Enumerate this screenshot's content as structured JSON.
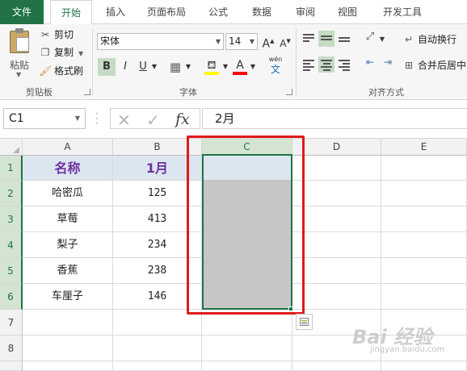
{
  "tabs": {
    "file": "文件",
    "home": "开始",
    "insert": "插入",
    "layout": "页面布局",
    "formulas": "公式",
    "data": "数据",
    "review": "审阅",
    "view": "视图",
    "developer": "开发工具"
  },
  "ribbon": {
    "clipboard": {
      "paste": "粘贴",
      "cut": "剪切",
      "copy": "复制",
      "format_painter": "格式刷",
      "group_label": "剪贴板"
    },
    "font": {
      "name": "宋体",
      "size": "14",
      "grow_label": "A",
      "shrink_label": "A",
      "bold": "B",
      "italic": "I",
      "underline": "U",
      "font_color_label": "A",
      "phonetic_top": "wén",
      "phonetic_bottom": "文",
      "group_label": "字体",
      "highlight_color": "#ffff00",
      "font_color": "#ff0000"
    },
    "alignment": {
      "wrap_text": "自动换行",
      "merge_center": "合并后居中",
      "group_label": "对齐方式"
    }
  },
  "formula_bar": {
    "name_box": "C1",
    "fx": "fx",
    "content": "2月"
  },
  "columns": [
    "A",
    "B",
    "C",
    "D",
    "E"
  ],
  "rows": [
    "1",
    "2",
    "3",
    "4",
    "5",
    "6",
    "7",
    "8"
  ],
  "table": {
    "headers": [
      "名称",
      "1月"
    ],
    "rows": [
      [
        "哈密瓜",
        "125"
      ],
      [
        "草莓",
        "413"
      ],
      [
        "梨子",
        "234"
      ],
      [
        "香蕉",
        "238"
      ],
      [
        "车厘子",
        "146"
      ]
    ]
  },
  "colors": {
    "accent": "#217346",
    "header_fill": "#dce6f1",
    "header_text": "#7030a0",
    "selection_fill": "#c6c6c6",
    "annotation": "#e0191b"
  },
  "watermark": {
    "main": "Bai 经验",
    "sub": "jingyan.baidu.com"
  }
}
